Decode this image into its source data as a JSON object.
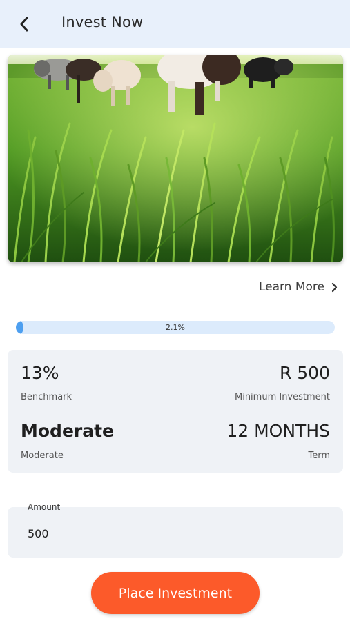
{
  "header": {
    "title": "Invest Now",
    "back_icon": "chevron-left-icon"
  },
  "hero": {
    "image_description_icon": "cattle-photo"
  },
  "learn_more": {
    "label": "Learn More",
    "icon": "chevron-right-icon"
  },
  "progress": {
    "percent": 2.1,
    "label": "2.1%",
    "track_color": "#dcebfc",
    "fill_color": "#4d9ff0"
  },
  "stats": {
    "benchmark_value": "13%",
    "benchmark_label": "Benchmark",
    "min_investment_value": "R 500",
    "min_investment_label": "Minimum Investment",
    "risk_value": "Moderate",
    "risk_label": "Moderate",
    "term_value": "12 MONTHS",
    "term_label": "Term"
  },
  "amount": {
    "label": "Amount",
    "value": "500"
  },
  "actions": {
    "place_investment_label": "Place Investment",
    "button_color": "#fc5a2a"
  }
}
